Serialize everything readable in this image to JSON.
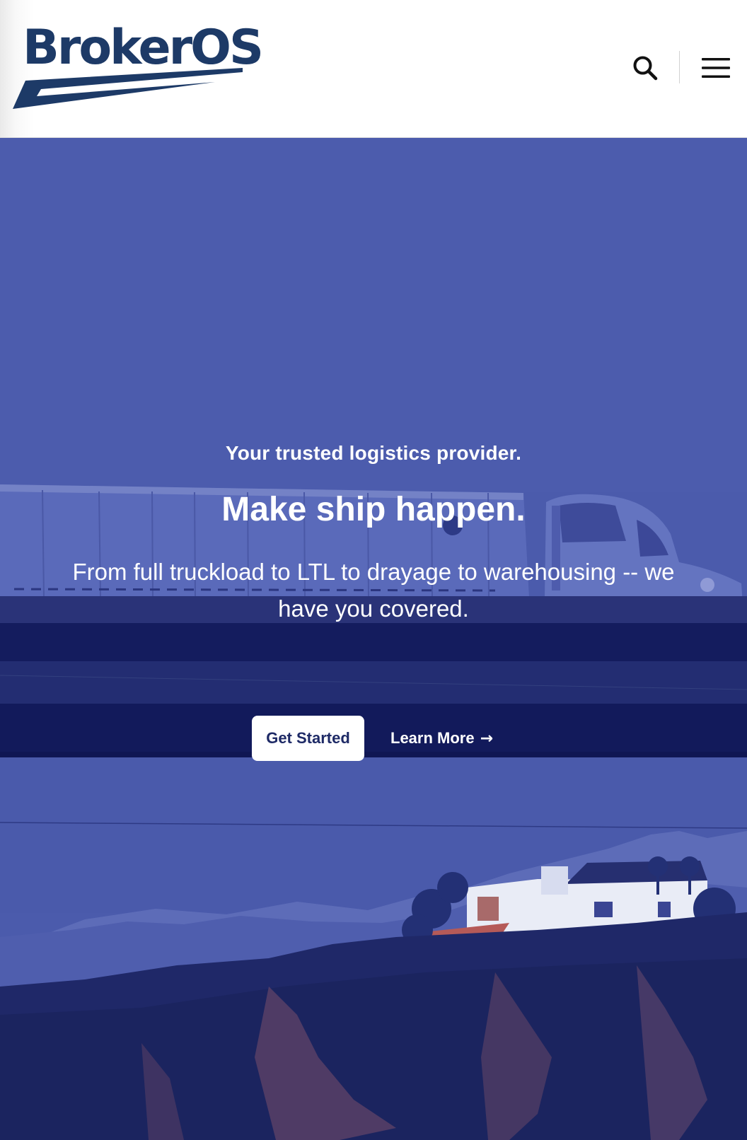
{
  "header": {
    "logo_text": "BrokerOS",
    "logo_color": "#1d3a67",
    "search_icon": "search-icon",
    "menu_icon": "hamburger-menu-icon"
  },
  "hero": {
    "tagline": "Your trusted logistics provider.",
    "title": "Make ship happen.",
    "subtitle": "From full truckload to LTL to drayage to warehousing -- we have you covered.",
    "primary_button_label": "Get Started",
    "secondary_button_label": "Learn More",
    "secondary_button_icon": "arrow-right-icon",
    "overlay_color": "#4b5bac",
    "background_scene": "semi-truck-on-overpass-desert-landscape"
  }
}
